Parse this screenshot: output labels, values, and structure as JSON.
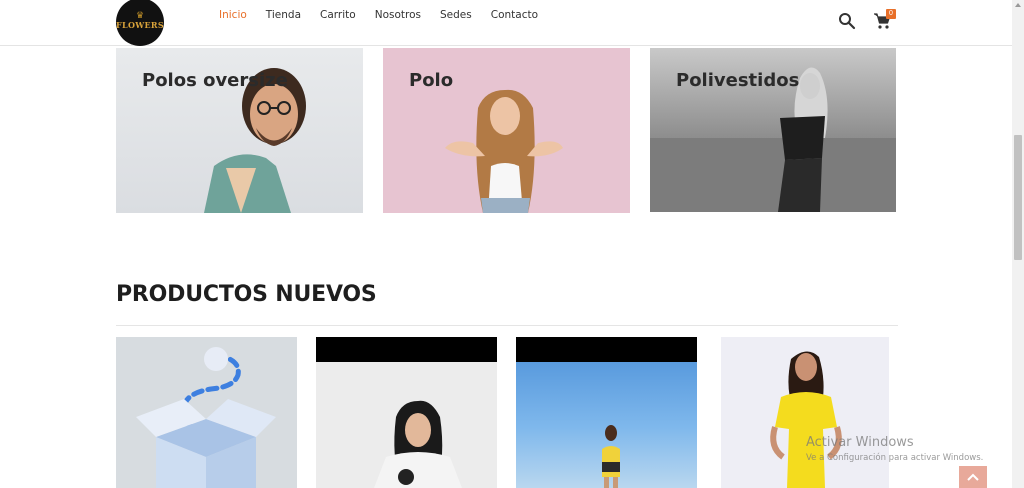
{
  "header": {
    "logo_text": "FLOWERS",
    "nav": [
      "Inicio",
      "Tienda",
      "Carrito",
      "Nosotros",
      "Sedes",
      "Contacto"
    ],
    "cart_count": "0"
  },
  "categories": [
    {
      "title": "Polos oversize"
    },
    {
      "title": "Polo"
    },
    {
      "title": "Polivestidos"
    }
  ],
  "section": {
    "title": "PRODUCTOS NUEVOS"
  },
  "watermark": {
    "line1": "Activar Windows",
    "line2": "Ve a Configuración para activar Windows."
  },
  "colors": {
    "accent": "#e8702a",
    "back_to_top": "#e8a99a"
  }
}
